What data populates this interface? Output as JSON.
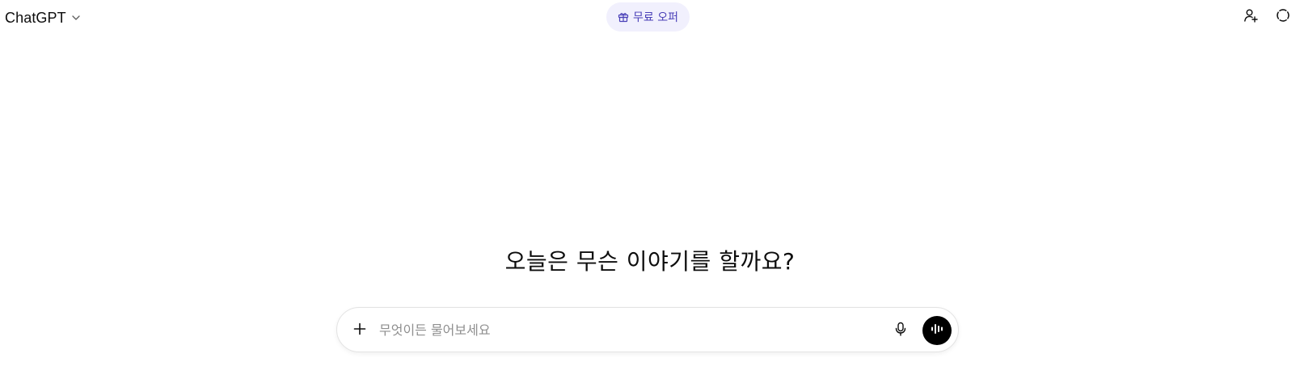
{
  "header": {
    "model_name": "ChatGPT",
    "offer_label": "무료 오퍼",
    "icons": {
      "model_dropdown": "chevron-down-icon",
      "offer": "gift-icon",
      "add_user": "add-user-icon",
      "temporary_chat": "temporary-chat-icon"
    }
  },
  "main": {
    "headline": "오늘은 무슨 이야기를 할까요?"
  },
  "composer": {
    "placeholder": "무엇이든 물어보세요",
    "value": "",
    "icons": {
      "attach": "plus-icon",
      "dictate": "microphone-icon",
      "voice_mode": "voice-waveform-icon"
    }
  },
  "colors": {
    "offer_background": "#f1f0fd",
    "offer_text": "#4a40b8",
    "voice_button": "#000000",
    "text": "#0d0d0d",
    "placeholder": "#8f8f8f"
  }
}
